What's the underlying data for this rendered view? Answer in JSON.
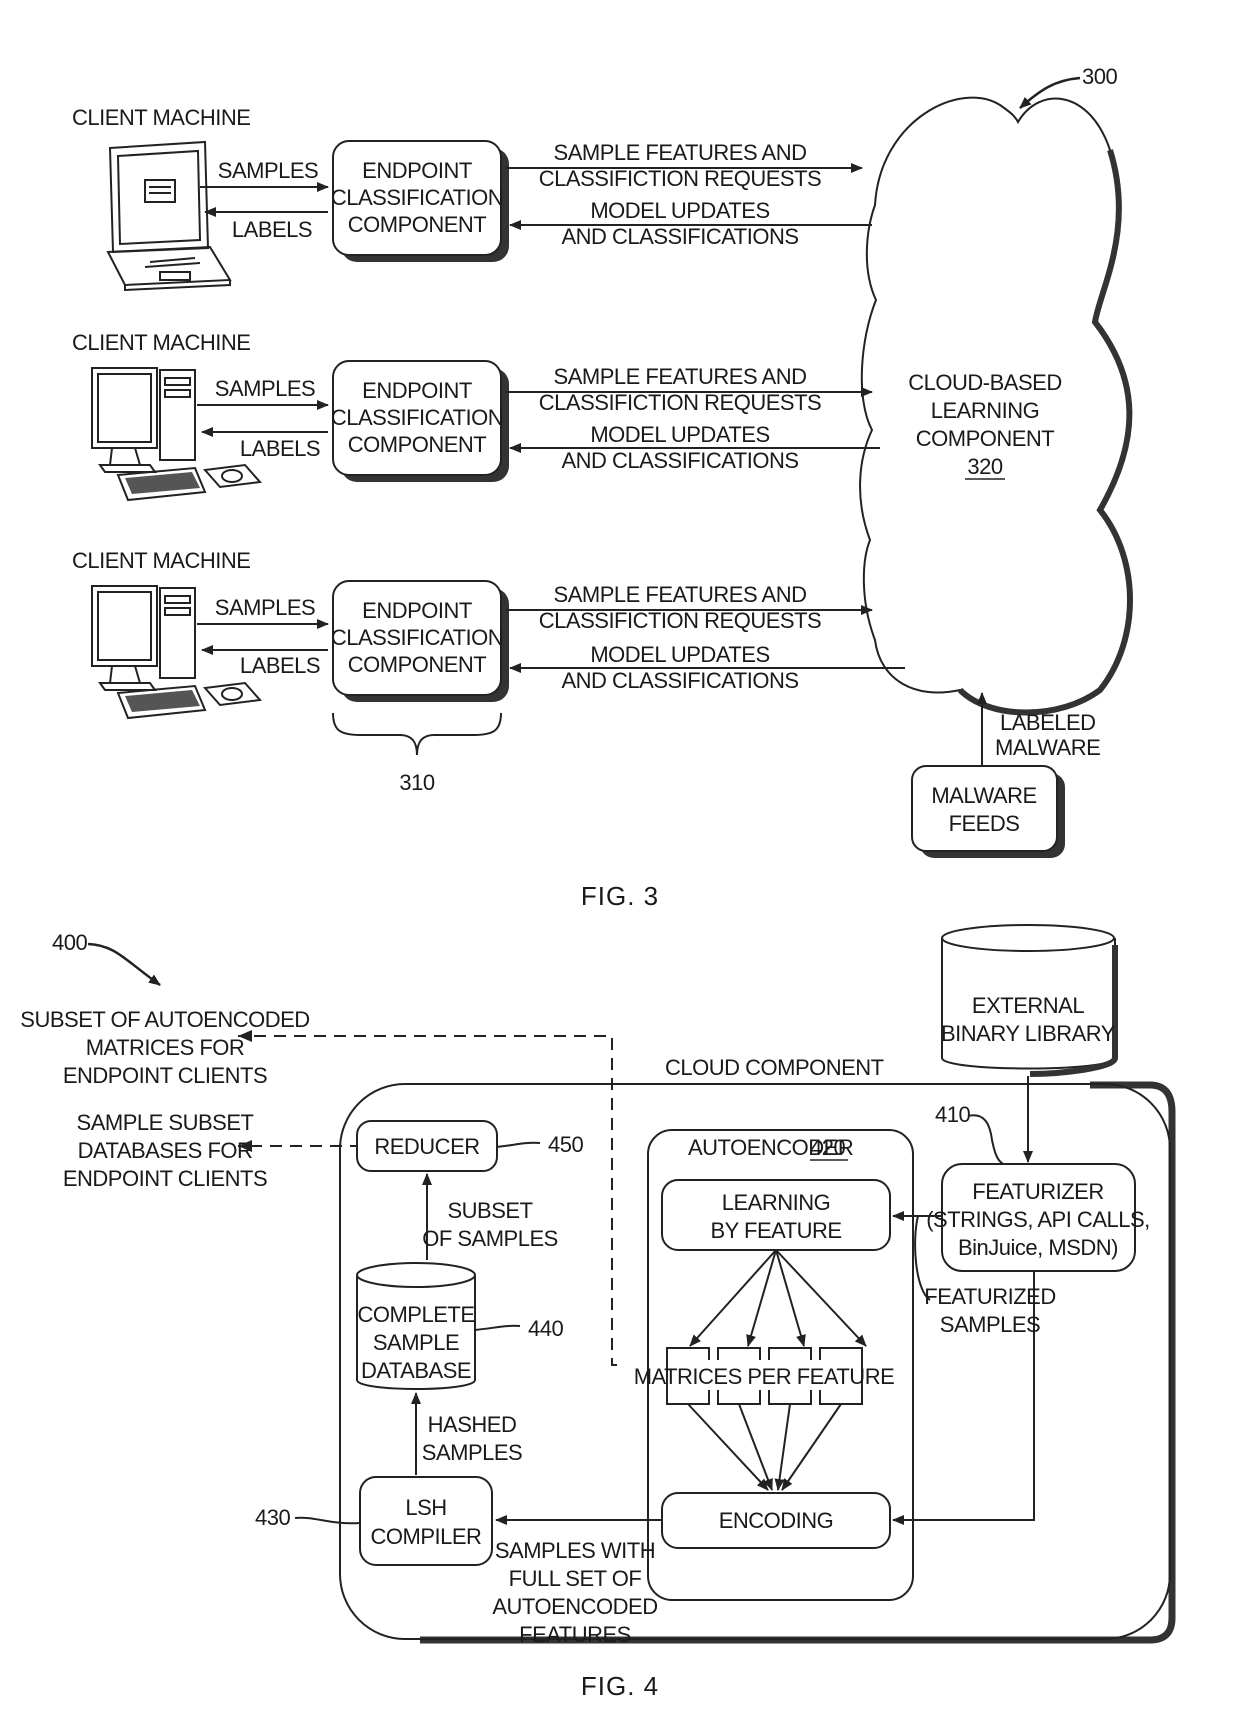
{
  "fig3": {
    "caption": "FIG. 3",
    "ref_number": "300",
    "bracket_ref": "310",
    "rows": [
      {
        "client_label": "CLIENT MACHINE",
        "device": "laptop",
        "samples_label": "SAMPLES",
        "labels_label": "LABELS",
        "endpoint_lines": [
          "ENDPOINT",
          "CLASSIFICATION",
          "COMPONENT"
        ],
        "up_lines": [
          "SAMPLE FEATURES AND",
          "CLASSIFICTION REQUESTS"
        ],
        "down_lines": [
          "MODEL UPDATES",
          "AND CLASSIFICATIONS"
        ]
      },
      {
        "client_label": "CLIENT MACHINE",
        "device": "desktop",
        "samples_label": "SAMPLES",
        "labels_label": "LABELS",
        "endpoint_lines": [
          "ENDPOINT",
          "CLASSIFICATION",
          "COMPONENT"
        ],
        "up_lines": [
          "SAMPLE FEATURES AND",
          "CLASSIFICTION REQUESTS"
        ],
        "down_lines": [
          "MODEL UPDATES",
          "AND CLASSIFICATIONS"
        ]
      },
      {
        "client_label": "CLIENT MACHINE",
        "device": "desktop",
        "samples_label": "SAMPLES",
        "labels_label": "LABELS",
        "endpoint_lines": [
          "ENDPOINT",
          "CLASSIFICATION",
          "COMPONENT"
        ],
        "up_lines": [
          "SAMPLE FEATURES AND",
          "CLASSIFICTION REQUESTS"
        ],
        "down_lines": [
          "MODEL UPDATES",
          "AND CLASSIFICATIONS"
        ]
      }
    ],
    "cloud": {
      "lines": [
        "CLOUD-BASED",
        "LEARNING",
        "COMPONENT"
      ],
      "ref": "320"
    },
    "labeled_malware_lines": [
      "LABELED",
      "MALWARE"
    ],
    "malware_feeds_lines": [
      "MALWARE",
      "FEEDS"
    ]
  },
  "fig4": {
    "caption": "FIG. 4",
    "ref_number": "400",
    "outputs": {
      "matrices_lines": [
        "SUBSET OF AUTOENCODED",
        "MATRICES FOR",
        "ENDPOINT CLIENTS"
      ],
      "databases_lines": [
        "SAMPLE SUBSET",
        "DATABASES FOR",
        "ENDPOINT CLIENTS"
      ]
    },
    "external_library_lines": [
      "EXTERNAL",
      "BINARY LIBRARY"
    ],
    "cloud_component_label": "CLOUD COMPONENT",
    "reducer": {
      "label": "REDUCER",
      "ref": "450"
    },
    "subset_of_samples_lines": [
      "SUBSET",
      "OF SAMPLES"
    ],
    "database": {
      "lines": [
        "COMPLETE",
        "SAMPLE",
        "DATABASE"
      ],
      "ref": "440"
    },
    "hashed_samples_lines": [
      "HASHED",
      "SAMPLES"
    ],
    "lsh": {
      "lines": [
        "LSH",
        "COMPILER"
      ],
      "ref": "430"
    },
    "samples_full_set_lines": [
      "SAMPLES WITH",
      "FULL SET OF",
      "AUTOENCODED",
      "FEATURES"
    ],
    "autoencoder": {
      "label": "AUTOENCODER",
      "ref": "420",
      "learning_lines": [
        "LEARNING",
        "BY FEATURE"
      ],
      "matrices_label": "MATRICES PER FEATURE",
      "encoding_label": "ENCODING"
    },
    "featurizer": {
      "ref": "410",
      "lines": [
        "FEATURIZER",
        "(STRINGS, API CALLS,",
        "BinJuice, MSDN)"
      ]
    },
    "featurized_samples_lines": [
      "FEATURIZED",
      "SAMPLES"
    ]
  }
}
